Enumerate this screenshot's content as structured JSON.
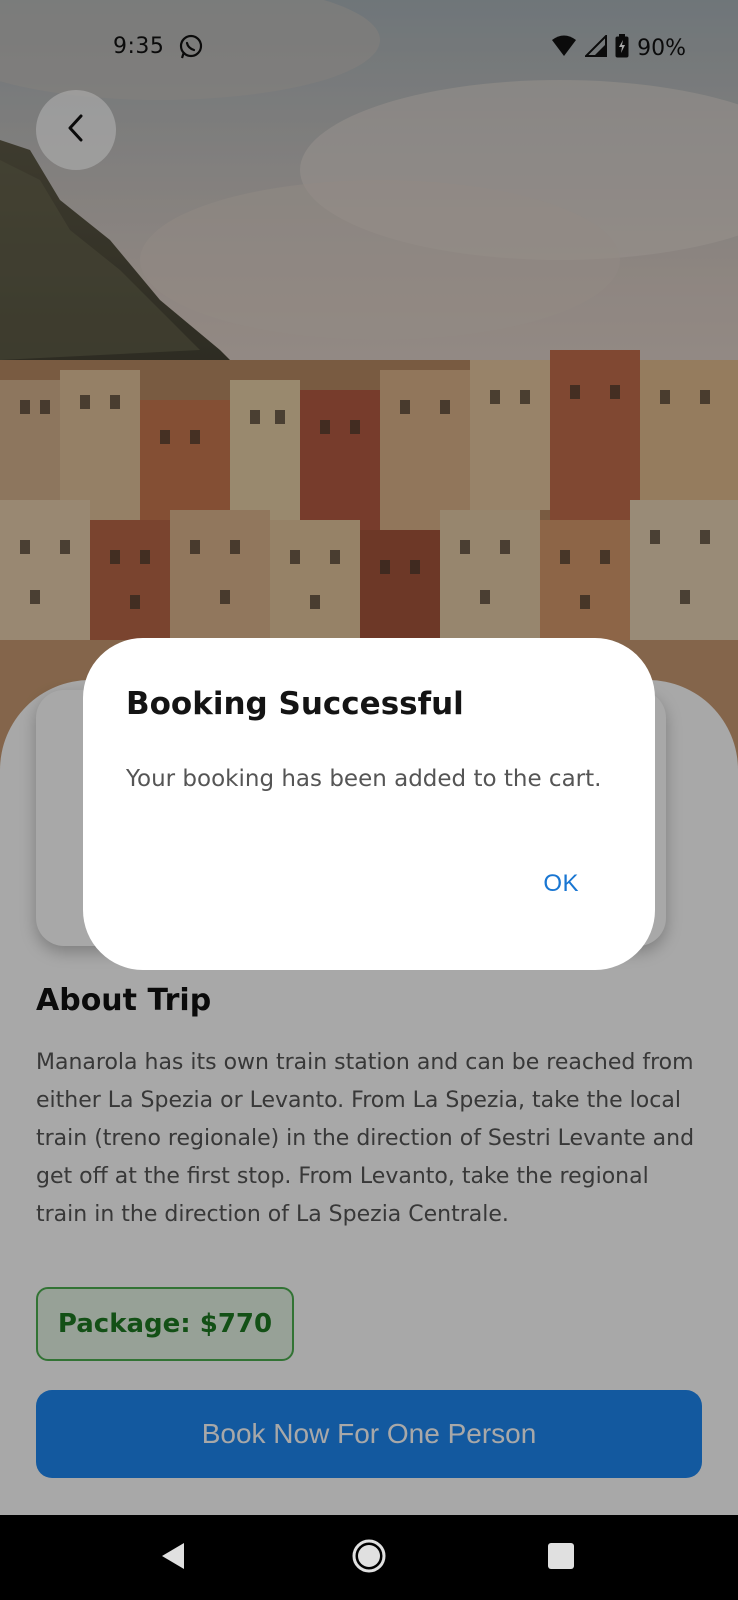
{
  "status_bar": {
    "time": "9:35",
    "battery": "90%",
    "icons": [
      "whatsapp-icon",
      "wifi-icon",
      "signal-icon",
      "battery-icon"
    ]
  },
  "hero": {
    "image": "Manarola village photo"
  },
  "about": {
    "title": "About Trip",
    "text": "Manarola has its own train station and can be reached from either La Spezia or Levanto. From La Spezia, take the local train (treno regionale) in the direction of Sestri Levante and get off at the first stop. From Levanto, take the regional train in the direction of La Spezia Centrale."
  },
  "package": {
    "label": "Package: $770"
  },
  "book_button": {
    "label": "Book Now For One Person"
  },
  "dialog": {
    "title": "Booking Successful",
    "message": "Your booking has been added to the cart.",
    "ok_label": "OK"
  },
  "colors": {
    "accent": "#1e88f2",
    "ok_text": "#1976d2",
    "package_text": "#1e7a22",
    "package_border": "#4caf50"
  }
}
